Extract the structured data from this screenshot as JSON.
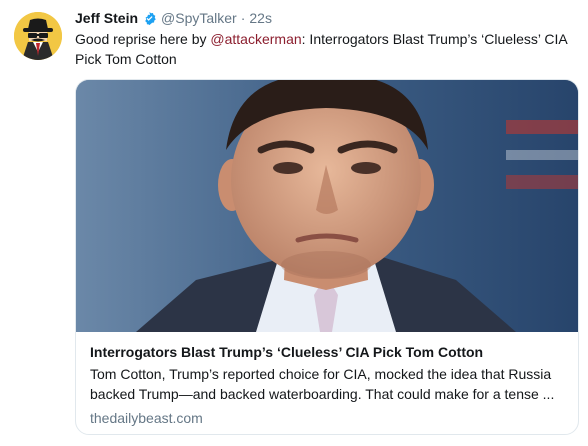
{
  "tweet": {
    "display_name": "Jeff Stein",
    "handle": "@SpyTalker",
    "separator": "·",
    "time": "22s",
    "text_before": "Good reprise here by ",
    "mention": "@attackerman",
    "text_after": ": Interrogators Blast Trump’s ‘Clueless’ CIA Pick Tom Cotton",
    "verified_icon": "verified-badge-icon",
    "colors": {
      "mention": "#8c1f2f",
      "verified": "#1da1f2",
      "muted": "#657786"
    }
  },
  "card": {
    "title": "Interrogators Blast Trump’s ‘Clueless’ CIA Pick Tom Cotton",
    "description_line1": "Tom Cotton, Trump’s reported choice for CIA, mocked the idea that Russia",
    "description_line2": "backed Trump—and backed waterboarding. That could make for a tense ...",
    "domain": "thedailybeast.com"
  }
}
